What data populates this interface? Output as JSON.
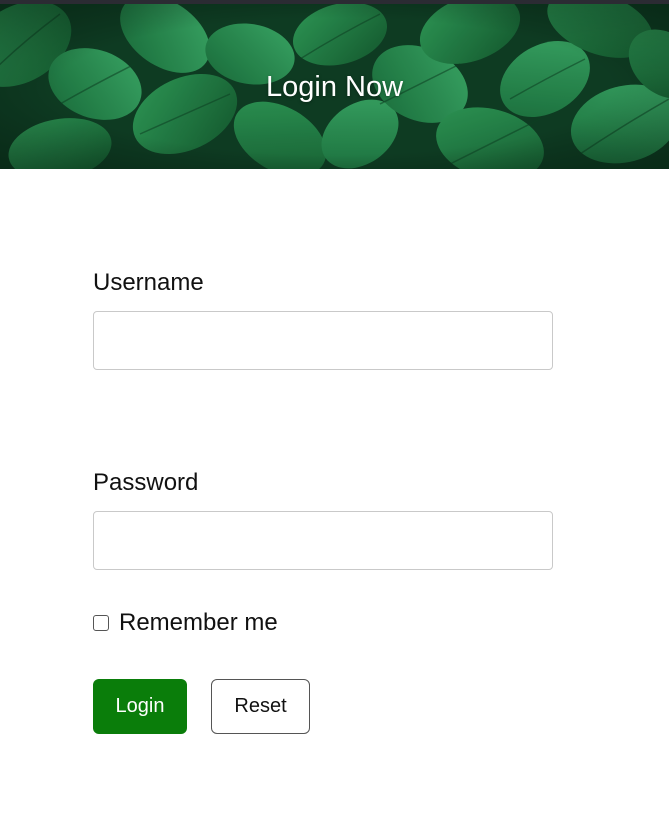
{
  "header": {
    "title": "Login Now"
  },
  "form": {
    "username_label": "Username",
    "username_value": "",
    "password_label": "Password",
    "password_value": "",
    "remember_label": "Remember me",
    "remember_checked": false
  },
  "buttons": {
    "login_label": "Login",
    "reset_label": "Reset"
  },
  "colors": {
    "accent": "#0a7d0a",
    "hero_green": "#1d6b3a"
  }
}
